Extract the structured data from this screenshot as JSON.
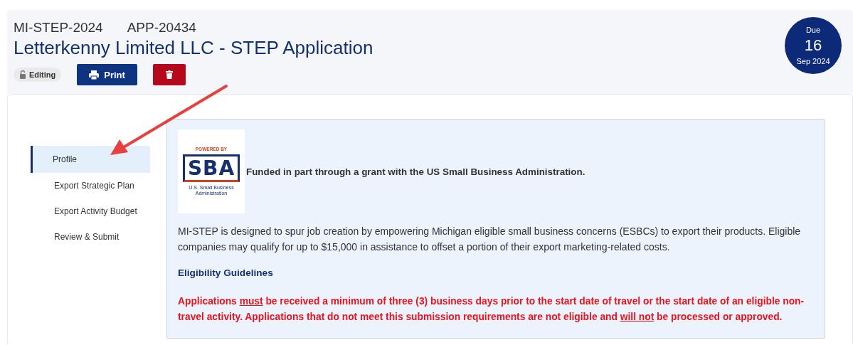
{
  "header": {
    "program": "MI-STEP-2024",
    "app_id": "APP-20434",
    "title": "Letterkenny Limited LLC - STEP Application",
    "status": {
      "label": "Editing",
      "locked": false
    },
    "buttons": [
      {
        "kind": "print",
        "label": "Print"
      },
      {
        "kind": "delete"
      }
    ],
    "due": {
      "label": "Due",
      "day": "16",
      "month_year": "Sep 2024"
    }
  },
  "sidebar": {
    "items": [
      {
        "label": "Profile",
        "selected": true
      },
      {
        "label": "Export Strategic Plan",
        "selected": false
      },
      {
        "label": "Export Activity Budget",
        "selected": false
      },
      {
        "label": "Review & Submit",
        "selected": false
      }
    ]
  },
  "panel": {
    "logo": {
      "top": "POWERED BY",
      "mark": "SBA",
      "caption": "U.S. Small Business Administration"
    },
    "funding_note": "Funded in part through a grant with the US Small Business Administration.",
    "description": "MI-STEP is designed to spur job creation by empowering Michigan eligible small business concerns (ESBCs) to export their products. Eligible companies may qualify for up to $15,000 in assistance to offset a portion of their export marketing-related costs.",
    "heading": "Eligibility Guidelines",
    "warning": [
      {
        "text": "Applications ",
        "underline": false
      },
      {
        "text": "must",
        "underline": true
      },
      {
        "text": " be received a minimum of three (3) business days prior to the start date of travel or the start date of an eligible non-travel activity. Applications that do not meet this submission requirements are not eligible and ",
        "underline": false
      },
      {
        "text": "will not",
        "underline": true
      },
      {
        "text": " be processed or approved.",
        "underline": false
      }
    ]
  }
}
